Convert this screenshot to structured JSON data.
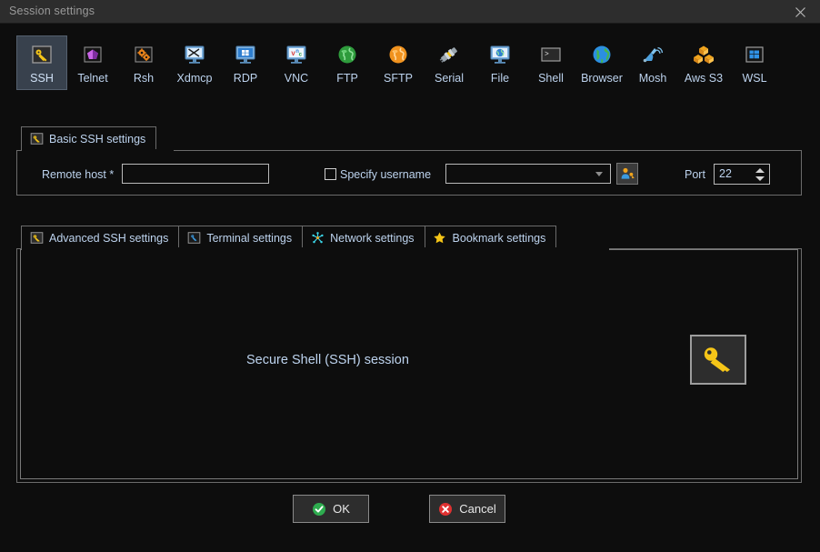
{
  "window": {
    "title": "Session settings",
    "close_icon": "close-x-icon"
  },
  "protocols": [
    {
      "label": "SSH",
      "icon": "ssh-key-icon",
      "selected": true
    },
    {
      "label": "Telnet",
      "icon": "telnet-cube-icon",
      "selected": false
    },
    {
      "label": "Rsh",
      "icon": "rsh-gears-icon",
      "selected": false
    },
    {
      "label": "Xdmcp",
      "icon": "xdmcp-monitor-icon",
      "selected": false
    },
    {
      "label": "RDP",
      "icon": "rdp-windows-icon",
      "selected": false
    },
    {
      "label": "VNC",
      "icon": "vnc-monitor-icon",
      "selected": false
    },
    {
      "label": "FTP",
      "icon": "ftp-globe-green-icon",
      "selected": false
    },
    {
      "label": "SFTP",
      "icon": "sftp-globe-orange-icon",
      "selected": false
    },
    {
      "label": "Serial",
      "icon": "serial-plug-icon",
      "selected": false
    },
    {
      "label": "File",
      "icon": "file-monitor-globe-icon",
      "selected": false
    },
    {
      "label": "Shell",
      "icon": "shell-prompt-icon",
      "selected": false
    },
    {
      "label": "Browser",
      "icon": "browser-globe-icon",
      "selected": false
    },
    {
      "label": "Mosh",
      "icon": "mosh-satellite-icon",
      "selected": false
    },
    {
      "label": "Aws S3",
      "icon": "aws-s3-boxes-icon",
      "selected": false
    },
    {
      "label": "WSL",
      "icon": "wsl-windows-icon",
      "selected": false
    }
  ],
  "basic_section": {
    "tab_label": "Basic SSH settings",
    "tab_icon": "ssh-key-icon",
    "remote_host_label": "Remote host *",
    "remote_host_value": "",
    "remote_host_placeholder": "",
    "specify_username_label": "Specify username",
    "specify_username_checked": false,
    "username_value": "",
    "username_caret_icon": "chevron-down-icon",
    "user_picker_icon": "user-key-icon",
    "port_label": "Port",
    "port_value": "22",
    "spin_up_icon": "spinner-up-icon",
    "spin_down_icon": "spinner-down-icon"
  },
  "settings_tabs": [
    {
      "label": "Advanced SSH settings",
      "icon": "ssh-key-icon",
      "active": true
    },
    {
      "label": "Terminal settings",
      "icon": "terminal-icon",
      "active": false
    },
    {
      "label": "Network settings",
      "icon": "network-node-icon",
      "active": false
    },
    {
      "label": "Bookmark settings",
      "icon": "star-icon",
      "active": false
    }
  ],
  "content": {
    "description": "Secure Shell (SSH) session",
    "big_icon": "ssh-key-icon"
  },
  "buttons": {
    "ok_label": "OK",
    "ok_icon": "check-circle-green-icon",
    "cancel_label": "Cancel",
    "cancel_icon": "x-circle-red-icon"
  },
  "colors": {
    "background": "#0d0d0d",
    "titlebar": "#2d2d2d",
    "label_text": "#bdd3ee",
    "accent_yellow": "#f5c518",
    "selected_tab_bg": "#38414d",
    "border": "#6b6b6b",
    "ok_green": "#2eac4f",
    "cancel_red": "#e03131"
  }
}
